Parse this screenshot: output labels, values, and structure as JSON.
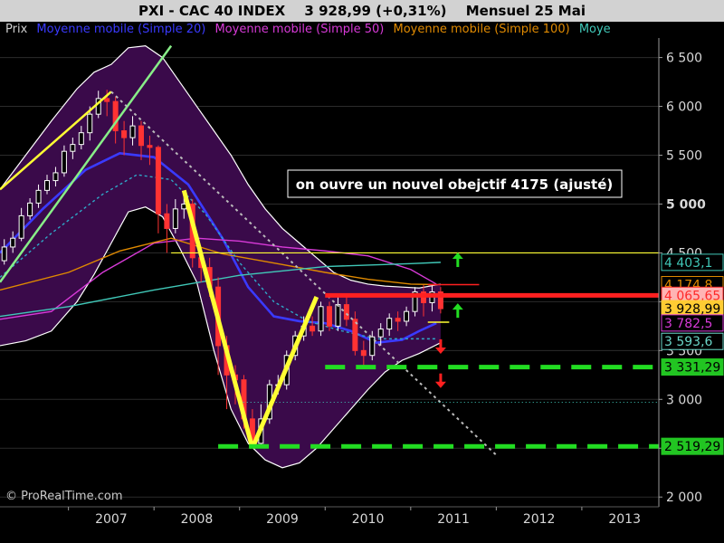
{
  "header": {
    "symbol": "PXI - CAC 40 INDEX",
    "quote": "3 928,99 (+0,31%)",
    "period": "Mensuel  25 Mai"
  },
  "legend": [
    {
      "label": "Prix",
      "color": "#cfcfcf"
    },
    {
      "label": "Moyenne mobile (Simple 20)",
      "color": "#3a3aff"
    },
    {
      "label": "Moyenne mobile (Simple 50)",
      "color": "#d83ad8"
    },
    {
      "label": "Moyenne mobile (Simple 100)",
      "color": "#e08a00"
    },
    {
      "label": "Moye",
      "color": "#40c8b8"
    }
  ],
  "annotation": "on ouvre un nouvel obejctif 4175 (ajusté)",
  "watermark": "© ProRealTime.com",
  "price_labels": [
    {
      "text": "4 403,1",
      "value": 4403.1,
      "bg": "#000000",
      "fg": "#40c8b8",
      "border": "#40c8b8"
    },
    {
      "text": "4 174,8",
      "value": 4174.8,
      "bg": "#000000",
      "fg": "#e08a00",
      "border": "#e08a00"
    },
    {
      "text": "4 065,65",
      "value": 4065.65,
      "bg": "#ffb4b4",
      "fg": "#ff2a2a",
      "border": "#ff2a2a"
    },
    {
      "text": "3 928,99",
      "value": 3928.99,
      "bg": "#ffcc33",
      "fg": "#000000",
      "border": "#ffcc33"
    },
    {
      "text": "3 782,5",
      "value": 3782.5,
      "bg": "#000000",
      "fg": "#d83ad8",
      "border": "#d83ad8"
    },
    {
      "text": "3 593,6",
      "value": 3593.6,
      "bg": "#000000",
      "fg": "#6ad6c8",
      "border": "#6ad6c8"
    },
    {
      "text": "3 331,29",
      "value": 3331.29,
      "bg": "#22c522",
      "fg": "#000000",
      "border": "#22c522"
    },
    {
      "text": "2 519,29",
      "value": 2519.29,
      "bg": "#22c522",
      "fg": "#000000",
      "border": "#22c522"
    }
  ],
  "colors": {
    "background": "#000000",
    "bollinger_fill": "#3a0a4a",
    "bollinger_edge": "#ffffff",
    "candle_up": "#ffffff",
    "candle_down": "#ff3333",
    "sma20": "#3a3aff",
    "sma50": "#d83ad8",
    "sma100": "#e08a00",
    "sma200": "#40c8b8",
    "trendline_yellow": "#ffff33",
    "trendline_green": "#88ee88",
    "support_green": "#22dd22",
    "resistance_red": "#ff2020",
    "arrow_up": "#22dd22",
    "arrow_down": "#ff2020"
  },
  "chart_data": {
    "type": "candlestick",
    "title": "PXI - CAC 40 INDEX",
    "x_tick_labels": [
      "2007",
      "2008",
      "2009",
      "2010",
      "2011",
      "2012",
      "2013"
    ],
    "y_tick_labels": [
      "2 000",
      "2 500",
      "3 000",
      "3 500",
      "4 000",
      "4 500",
      "5 000",
      "5 500",
      "6 000",
      "6 500"
    ],
    "y_ticks": [
      2000,
      2500,
      3000,
      3500,
      4000,
      4500,
      5000,
      5500,
      6000,
      6500
    ],
    "y_bold_labels": [
      "5 000"
    ],
    "xlim": [
      2006.2,
      2013.9
    ],
    "ylim": [
      1900,
      6700
    ],
    "grid": true,
    "legend_position": "top-left",
    "series": [
      {
        "name": "Moyenne mobile (Simple 20)",
        "color": "#3a3aff",
        "x": [
          2006.2,
          2006.7,
          2007.2,
          2007.6,
          2008.0,
          2008.4,
          2008.8,
          2009.1,
          2009.4,
          2009.7,
          2010.0,
          2010.3,
          2010.6,
          2010.9,
          2011.1,
          2011.3
        ],
        "y": [
          4500,
          4950,
          5350,
          5520,
          5480,
          5200,
          4650,
          4150,
          3850,
          3800,
          3780,
          3700,
          3580,
          3610,
          3700,
          3780
        ]
      },
      {
        "name": "Moyenne mobile (Simple 50)",
        "color": "#d83ad8",
        "x": [
          2006.2,
          2006.8,
          2007.4,
          2008.0,
          2008.5,
          2009.0,
          2009.5,
          2010.0,
          2010.5,
          2011.0,
          2011.3
        ],
        "y": [
          3820,
          3900,
          4300,
          4600,
          4650,
          4620,
          4560,
          4520,
          4470,
          4330,
          4180
        ]
      },
      {
        "name": "Moyenne mobile (Simple 100)",
        "color": "#e08a00",
        "x": [
          2006.2,
          2007.0,
          2007.6,
          2008.2,
          2008.8,
          2009.5,
          2010.0,
          2010.5,
          2011.0,
          2011.3
        ],
        "y": [
          4120,
          4300,
          4520,
          4650,
          4490,
          4380,
          4300,
          4230,
          4180,
          4175
        ]
      },
      {
        "name": "Moye",
        "color": "#40c8b8",
        "x": [
          2006.2,
          2007.0,
          2008.0,
          2009.0,
          2010.0,
          2011.0,
          2011.35
        ],
        "y": [
          3850,
          3950,
          4120,
          4270,
          4360,
          4390,
          4403
        ]
      },
      {
        "name": "Moye (pointillé)",
        "color": "#2fa8c8",
        "x": [
          2006.2,
          2006.8,
          2007.4,
          2007.8,
          2008.2,
          2008.6,
          2009.0,
          2009.4,
          2009.8,
          2010.2,
          2010.6,
          2011.0,
          2011.3
        ],
        "y": [
          4250,
          4700,
          5100,
          5300,
          5250,
          4900,
          4400,
          4000,
          3800,
          3700,
          3620,
          3620,
          3620
        ]
      }
    ],
    "candles": [
      {
        "x": 2006.25,
        "o": 4420,
        "c": 4560,
        "h": 4640,
        "l": 4380
      },
      {
        "x": 2006.35,
        "o": 4560,
        "c": 4650,
        "h": 4720,
        "l": 4500
      },
      {
        "x": 2006.45,
        "o": 4650,
        "c": 4880,
        "h": 4960,
        "l": 4620
      },
      {
        "x": 2006.55,
        "o": 4880,
        "c": 5010,
        "h": 5060,
        "l": 4840
      },
      {
        "x": 2006.65,
        "o": 5010,
        "c": 5140,
        "h": 5200,
        "l": 4960
      },
      {
        "x": 2006.75,
        "o": 5140,
        "c": 5240,
        "h": 5300,
        "l": 5100
      },
      {
        "x": 2006.85,
        "o": 5240,
        "c": 5320,
        "h": 5380,
        "l": 5180
      },
      {
        "x": 2006.95,
        "o": 5320,
        "c": 5540,
        "h": 5600,
        "l": 5280
      },
      {
        "x": 2007.05,
        "o": 5540,
        "c": 5610,
        "h": 5680,
        "l": 5460
      },
      {
        "x": 2007.15,
        "o": 5610,
        "c": 5730,
        "h": 5800,
        "l": 5560
      },
      {
        "x": 2007.25,
        "o": 5730,
        "c": 5920,
        "h": 6000,
        "l": 5650
      },
      {
        "x": 2007.35,
        "o": 5920,
        "c": 6080,
        "h": 6160,
        "l": 5880
      },
      {
        "x": 2007.45,
        "o": 6080,
        "c": 6050,
        "h": 6170,
        "l": 5900
      },
      {
        "x": 2007.55,
        "o": 6050,
        "c": 5750,
        "h": 6100,
        "l": 5620
      },
      {
        "x": 2007.65,
        "o": 5750,
        "c": 5680,
        "h": 5850,
        "l": 5500
      },
      {
        "x": 2007.75,
        "o": 5680,
        "c": 5800,
        "h": 5900,
        "l": 5600
      },
      {
        "x": 2007.85,
        "o": 5800,
        "c": 5600,
        "h": 5850,
        "l": 5450
      },
      {
        "x": 2007.95,
        "o": 5600,
        "c": 5580,
        "h": 5700,
        "l": 5400
      },
      {
        "x": 2008.05,
        "o": 5580,
        "c": 4900,
        "h": 5600,
        "l": 4700
      },
      {
        "x": 2008.15,
        "o": 4900,
        "c": 4750,
        "h": 5000,
        "l": 4500
      },
      {
        "x": 2008.25,
        "o": 4750,
        "c": 4950,
        "h": 5050,
        "l": 4700
      },
      {
        "x": 2008.35,
        "o": 4950,
        "c": 5000,
        "h": 5100,
        "l": 4850
      },
      {
        "x": 2008.45,
        "o": 5000,
        "c": 4450,
        "h": 5050,
        "l": 4350
      },
      {
        "x": 2008.55,
        "o": 4450,
        "c": 4350,
        "h": 4500,
        "l": 4200
      },
      {
        "x": 2008.65,
        "o": 4350,
        "c": 4150,
        "h": 4450,
        "l": 4050
      },
      {
        "x": 2008.75,
        "o": 4150,
        "c": 3550,
        "h": 4250,
        "l": 3250
      },
      {
        "x": 2008.85,
        "o": 3550,
        "c": 3250,
        "h": 3650,
        "l": 2900
      },
      {
        "x": 2008.95,
        "o": 3250,
        "c": 3200,
        "h": 3350,
        "l": 2950
      },
      {
        "x": 2009.05,
        "o": 3200,
        "c": 2800,
        "h": 3250,
        "l": 2700
      },
      {
        "x": 2009.15,
        "o": 2800,
        "c": 2550,
        "h": 2900,
        "l": 2500
      },
      {
        "x": 2009.25,
        "o": 2550,
        "c": 2800,
        "h": 2950,
        "l": 2500
      },
      {
        "x": 2009.35,
        "o": 2800,
        "c": 3150,
        "h": 3200,
        "l": 2750
      },
      {
        "x": 2009.45,
        "o": 3150,
        "c": 3150,
        "h": 3250,
        "l": 3050
      },
      {
        "x": 2009.55,
        "o": 3150,
        "c": 3450,
        "h": 3500,
        "l": 3100
      },
      {
        "x": 2009.65,
        "o": 3450,
        "c": 3650,
        "h": 3700,
        "l": 3400
      },
      {
        "x": 2009.75,
        "o": 3650,
        "c": 3750,
        "h": 3850,
        "l": 3600
      },
      {
        "x": 2009.85,
        "o": 3750,
        "c": 3700,
        "h": 3850,
        "l": 3650
      },
      {
        "x": 2009.95,
        "o": 3700,
        "c": 3950,
        "h": 4000,
        "l": 3650
      },
      {
        "x": 2010.05,
        "o": 3950,
        "c": 3750,
        "h": 4000,
        "l": 3700
      },
      {
        "x": 2010.15,
        "o": 3750,
        "c": 3970,
        "h": 4050,
        "l": 3700
      },
      {
        "x": 2010.25,
        "o": 3970,
        "c": 3820,
        "h": 4050,
        "l": 3750
      },
      {
        "x": 2010.35,
        "o": 3820,
        "c": 3500,
        "h": 3900,
        "l": 3450
      },
      {
        "x": 2010.45,
        "o": 3500,
        "c": 3450,
        "h": 3600,
        "l": 3350
      },
      {
        "x": 2010.55,
        "o": 3450,
        "c": 3640,
        "h": 3700,
        "l": 3400
      },
      {
        "x": 2010.65,
        "o": 3640,
        "c": 3720,
        "h": 3780,
        "l": 3550
      },
      {
        "x": 2010.75,
        "o": 3720,
        "c": 3830,
        "h": 3880,
        "l": 3650
      },
      {
        "x": 2010.85,
        "o": 3830,
        "c": 3800,
        "h": 3900,
        "l": 3700
      },
      {
        "x": 2010.95,
        "o": 3800,
        "c": 3900,
        "h": 3950,
        "l": 3750
      },
      {
        "x": 2011.05,
        "o": 3900,
        "c": 4100,
        "h": 4150,
        "l": 3850
      },
      {
        "x": 2011.15,
        "o": 4100,
        "c": 3990,
        "h": 4170,
        "l": 3850
      },
      {
        "x": 2011.25,
        "o": 3990,
        "c": 4100,
        "h": 4170,
        "l": 3900
      },
      {
        "x": 2011.35,
        "o": 4100,
        "c": 3929,
        "h": 4150,
        "l": 3880
      }
    ],
    "bollinger_upper": {
      "x": [
        2006.2,
        2006.5,
        2006.8,
        2007.1,
        2007.3,
        2007.5,
        2007.7,
        2007.9,
        2008.1,
        2008.3,
        2008.5,
        2008.7,
        2008.9,
        2009.1,
        2009.3,
        2009.5,
        2009.7,
        2009.9,
        2010.1,
        2010.3,
        2010.5,
        2010.7,
        2010.9,
        2011.1,
        2011.35
      ],
      "y": [
        5150,
        5500,
        5850,
        6180,
        6350,
        6430,
        6600,
        6620,
        6500,
        6250,
        6000,
        5750,
        5500,
        5200,
        4950,
        4750,
        4600,
        4450,
        4300,
        4220,
        4180,
        4160,
        4150,
        4140,
        4180
      ]
    },
    "bollinger_lower": {
      "x": [
        2006.2,
        2006.5,
        2006.8,
        2007.1,
        2007.3,
        2007.5,
        2007.7,
        2007.9,
        2008.1,
        2008.3,
        2008.5,
        2008.7,
        2008.9,
        2009.1,
        2009.3,
        2009.5,
        2009.7,
        2009.9,
        2010.1,
        2010.3,
        2010.5,
        2010.7,
        2010.9,
        2011.1,
        2011.35
      ],
      "y": [
        3550,
        3600,
        3700,
        4000,
        4280,
        4600,
        4920,
        4970,
        4870,
        4550,
        4200,
        3500,
        2900,
        2550,
        2380,
        2300,
        2350,
        2500,
        2700,
        2900,
        3100,
        3280,
        3400,
        3470,
        3580
      ]
    },
    "lines": [
      {
        "name": "yellow-trendline-top",
        "color": "#ffff33",
        "x": [
          2006.2,
          2007.5
        ],
        "y": [
          5150,
          6150
        ],
        "width": 2.5
      },
      {
        "name": "green-channel-line",
        "color": "#88ee88",
        "x": [
          2006.2,
          2008.2
        ],
        "y": [
          4200,
          6620
        ],
        "width": 2.5
      },
      {
        "name": "grey-dotted-trendline",
        "color": "#bbbbbb",
        "x": [
          2007.5,
          2012.0
        ],
        "y": [
          6150,
          2430
        ],
        "width": 2,
        "dash": "3,4"
      },
      {
        "name": "yellow-line-4500",
        "color": "#ffff33",
        "x": [
          2008.2,
          2013.9
        ],
        "y": [
          4500,
          4500
        ],
        "width": 1.2
      },
      {
        "name": "red-resistance-4065",
        "color": "#ff2020",
        "x": [
          2010.0,
          2013.9
        ],
        "y": [
          4065,
          4065
        ],
        "width": 5
      },
      {
        "name": "red-short-4175",
        "color": "#ff2020",
        "x": [
          2011.2,
          2011.8
        ],
        "y": [
          4175,
          4175
        ],
        "width": 1.5
      },
      {
        "name": "yellow-short-3790",
        "color": "#ffff33",
        "x": [
          2011.2,
          2011.45
        ],
        "y": [
          3790,
          3790
        ],
        "width": 1.5
      },
      {
        "name": "cyan-dotted-2970",
        "color": "#40c8b8",
        "x": [
          2009.0,
          2013.9
        ],
        "y": [
          2970,
          2970
        ],
        "width": 1,
        "dash": "1,3"
      },
      {
        "name": "yellow-impulse-down",
        "color": "#ffff33",
        "x": [
          2008.35,
          2009.15
        ],
        "y": [
          5140,
          2500
        ],
        "width": 5
      },
      {
        "name": "yellow-impulse-up",
        "color": "#ffff33",
        "x": [
          2009.15,
          2009.9
        ],
        "y": [
          2500,
          4050
        ],
        "width": 5
      },
      {
        "name": "green-support-3331",
        "color": "#22dd22",
        "x": [
          2010.0,
          2013.9
        ],
        "y": [
          3331,
          3331
        ],
        "width": 5,
        "dash": "22,12"
      },
      {
        "name": "green-support-2519",
        "color": "#22dd22",
        "x": [
          2008.75,
          2013.9
        ],
        "y": [
          2519,
          2519
        ],
        "width": 5,
        "dash": "22,12"
      }
    ],
    "arrows": [
      {
        "name": "green-up-arrow",
        "x": 2011.55,
        "y": 4420,
        "dir": "up",
        "color": "#22dd22"
      },
      {
        "name": "green-up-arrow",
        "x": 2011.55,
        "y": 3900,
        "dir": "up",
        "color": "#22dd22"
      },
      {
        "name": "red-down-arrow",
        "x": 2011.35,
        "y": 3550,
        "dir": "down",
        "color": "#ff2020"
      },
      {
        "name": "red-down-arrow",
        "x": 2011.35,
        "y": 3200,
        "dir": "down",
        "color": "#ff2020"
      }
    ]
  }
}
